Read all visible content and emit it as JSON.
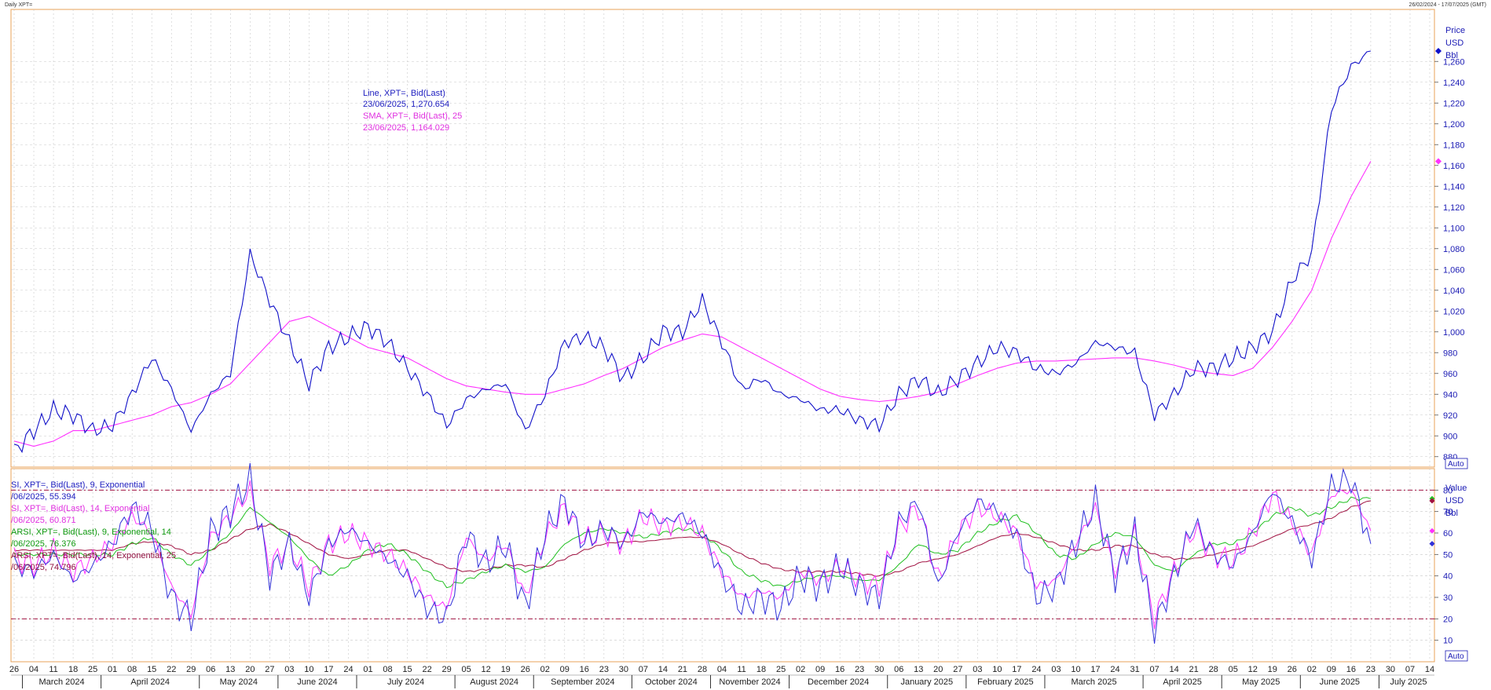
{
  "window": {
    "title_left": "Daily XPT=",
    "title_right": "26/02/2024 - 17/07/2025 (GMT)"
  },
  "colors": {
    "frame": "#e8a35a",
    "grid": "#c8c8c8",
    "price": "#1010c8",
    "sma": "#ff30ff",
    "rsi9": "#3030d8",
    "rsi14": "#ff30ff",
    "marsi9": "#20c020",
    "marsi14": "#a01040",
    "refline": "#a01040",
    "axis_text": "#1a1ab4"
  },
  "price_axis": {
    "label_line1": "Price",
    "label_line2": "USD",
    "label_line3": "Bbl",
    "auto_button": "Auto"
  },
  "rsi_axis": {
    "label_line1": "Value",
    "label_line2": "USD",
    "label_line3": "Bbl",
    "auto_button": "Auto"
  },
  "legend_top": {
    "line1": "Line, XPT=, Bid(Last)",
    "line2": "23/06/2025, 1,270.654",
    "line3": "SMA, XPT=, Bid(Last),  25",
    "line4": "23/06/2025, 1,164.029"
  },
  "legend_bottom": {
    "line1": "SI, XPT=, Bid(Last),  9, Exponential",
    "line2": "/06/2025, 55.394",
    "line3": "SI, XPT=, Bid(Last),  14, Exponential",
    "line4": "/06/2025, 60.871",
    "line5": "ARSI, XPT=, Bid(Last),  9, Exponential, 14",
    "line6": "/06/2025, 76.376",
    "line7": "ARSI, XPT=, Bid(Last),  14, Exponential, 25",
    "line8": "/06/2025, 74.796"
  },
  "chart_data": [
    {
      "type": "line",
      "title": "Daily XPT=",
      "ylabel": "Price USD Bbl",
      "ylim": [
        870,
        1310
      ],
      "yticks": [
        "880",
        "900",
        "920",
        "940",
        "960",
        "980",
        "1,000",
        "1,020",
        "1,040",
        "1,060",
        "1,080",
        "1,100",
        "1,120",
        "1,140",
        "1,160",
        "1,180",
        "1,200",
        "1,220",
        "1,240",
        "1,260"
      ],
      "grid": true,
      "x": [
        "2024-02-26",
        "2024-03-04",
        "2024-03-11",
        "2024-03-18",
        "2024-03-25",
        "2024-04-01",
        "2024-04-08",
        "2024-04-15",
        "2024-04-22",
        "2024-04-29",
        "2024-05-06",
        "2024-05-13",
        "2024-05-20",
        "2024-05-27",
        "2024-06-03",
        "2024-06-10",
        "2024-06-17",
        "2024-06-24",
        "2024-07-01",
        "2024-07-08",
        "2024-07-15",
        "2024-07-22",
        "2024-07-29",
        "2024-08-05",
        "2024-08-12",
        "2024-08-19",
        "2024-08-26",
        "2024-09-02",
        "2024-09-09",
        "2024-09-16",
        "2024-09-23",
        "2024-09-30",
        "2024-10-07",
        "2024-10-14",
        "2024-10-21",
        "2024-10-28",
        "2024-11-04",
        "2024-11-11",
        "2024-11-18",
        "2024-11-25",
        "2024-12-02",
        "2024-12-09",
        "2024-12-16",
        "2024-12-23",
        "2024-12-30",
        "2025-01-06",
        "2025-01-13",
        "2025-01-20",
        "2025-01-27",
        "2025-02-03",
        "2025-02-10",
        "2025-02-17",
        "2025-02-24",
        "2025-03-03",
        "2025-03-10",
        "2025-03-17",
        "2025-03-24",
        "2025-03-31",
        "2025-04-07",
        "2025-04-14",
        "2025-04-21",
        "2025-04-28",
        "2025-05-05",
        "2025-05-12",
        "2025-05-19",
        "2025-05-26",
        "2025-06-02",
        "2025-06-09",
        "2025-06-16",
        "2025-06-23"
      ],
      "series": [
        {
          "name": "Line, XPT=, Bid(Last)",
          "values": [
            885,
            905,
            925,
            920,
            905,
            910,
            940,
            975,
            945,
            905,
            940,
            960,
            1075,
            1030,
            990,
            950,
            985,
            995,
            1005,
            990,
            965,
            940,
            910,
            935,
            945,
            950,
            905,
            940,
            990,
            995,
            985,
            955,
            975,
            1000,
            1000,
            1030,
            990,
            945,
            955,
            940,
            935,
            925,
            925,
            915,
            910,
            940,
            955,
            940,
            955,
            970,
            985,
            980,
            965,
            960,
            970,
            990,
            985,
            980,
            920,
            940,
            965,
            965,
            975,
            985,
            1000,
            1050,
            1075,
            1215,
            1255,
            1270
          ]
        },
        {
          "name": "SMA, XPT=, Bid(Last),  25",
          "values": [
            895,
            890,
            895,
            905,
            905,
            910,
            915,
            920,
            928,
            932,
            940,
            950,
            970,
            990,
            1010,
            1015,
            1005,
            995,
            985,
            980,
            975,
            965,
            955,
            948,
            945,
            942,
            940,
            940,
            945,
            950,
            958,
            965,
            975,
            985,
            992,
            998,
            995,
            985,
            975,
            965,
            955,
            945,
            938,
            935,
            933,
            935,
            938,
            942,
            950,
            958,
            965,
            970,
            972,
            972,
            973,
            974,
            975,
            975,
            972,
            968,
            963,
            960,
            958,
            965,
            985,
            1010,
            1040,
            1090,
            1130,
            1164
          ]
        }
      ]
    },
    {
      "type": "line",
      "ylabel": "Value USD Bbl",
      "ylim": [
        0,
        90
      ],
      "yticks": [
        "10",
        "20",
        "30",
        "40",
        "50",
        "60",
        "70",
        "80"
      ],
      "reference_lines": [
        20,
        80
      ],
      "grid": true,
      "x": [
        "2024-02-26",
        "2024-03-04",
        "2024-03-11",
        "2024-03-18",
        "2024-03-25",
        "2024-04-01",
        "2024-04-08",
        "2024-04-15",
        "2024-04-22",
        "2024-04-29",
        "2024-05-06",
        "2024-05-13",
        "2024-05-20",
        "2024-05-27",
        "2024-06-03",
        "2024-06-10",
        "2024-06-17",
        "2024-06-24",
        "2024-07-01",
        "2024-07-08",
        "2024-07-15",
        "2024-07-22",
        "2024-07-29",
        "2024-08-05",
        "2024-08-12",
        "2024-08-19",
        "2024-08-26",
        "2024-09-02",
        "2024-09-09",
        "2024-09-16",
        "2024-09-23",
        "2024-09-30",
        "2024-10-07",
        "2024-10-14",
        "2024-10-21",
        "2024-10-28",
        "2024-11-04",
        "2024-11-11",
        "2024-11-18",
        "2024-11-25",
        "2024-12-02",
        "2024-12-09",
        "2024-12-16",
        "2024-12-23",
        "2024-12-30",
        "2025-01-06",
        "2025-01-13",
        "2025-01-20",
        "2025-01-27",
        "2025-02-03",
        "2025-02-10",
        "2025-02-17",
        "2025-02-24",
        "2025-03-03",
        "2025-03-10",
        "2025-03-17",
        "2025-03-24",
        "2025-03-31",
        "2025-04-07",
        "2025-04-14",
        "2025-04-21",
        "2025-04-28",
        "2025-05-05",
        "2025-05-12",
        "2025-05-19",
        "2025-05-26",
        "2025-06-02",
        "2025-06-09",
        "2025-06-16",
        "2025-06-23"
      ],
      "series": [
        {
          "name": "SI, XPT=, Bid(Last),  9, Exponential",
          "values": [
            45,
            42,
            50,
            38,
            45,
            55,
            72,
            62,
            30,
            20,
            60,
            70,
            85,
            40,
            55,
            30,
            55,
            62,
            55,
            48,
            40,
            25,
            20,
            60,
            45,
            55,
            25,
            60,
            75,
            55,
            62,
            55,
            70,
            65,
            68,
            60,
            40,
            25,
            30,
            25,
            40,
            35,
            45,
            35,
            30,
            65,
            75,
            35,
            60,
            75,
            70,
            60,
            30,
            35,
            55,
            75,
            40,
            60,
            15,
            40,
            65,
            50,
            45,
            60,
            80,
            65,
            48,
            82,
            85,
            55
          ]
        },
        {
          "name": "SI, XPT=, Bid(Last),  14, Exponential",
          "values": [
            48,
            45,
            52,
            42,
            48,
            55,
            68,
            60,
            35,
            22,
            58,
            68,
            80,
            45,
            55,
            35,
            55,
            60,
            55,
            50,
            42,
            30,
            25,
            58,
            47,
            55,
            30,
            58,
            72,
            57,
            60,
            55,
            68,
            63,
            65,
            60,
            42,
            30,
            33,
            30,
            42,
            38,
            45,
            38,
            35,
            62,
            72,
            38,
            60,
            72,
            68,
            60,
            35,
            38,
            55,
            72,
            42,
            60,
            20,
            42,
            62,
            50,
            47,
            60,
            78,
            65,
            50,
            78,
            80,
            61
          ]
        },
        {
          "name": "ARSI, XPT=, Bid(Last),  9, Exponential, 14",
          "values": [
            50,
            50,
            50,
            50,
            50,
            50,
            55,
            58,
            50,
            45,
            52,
            60,
            72,
            65,
            58,
            48,
            40,
            45,
            52,
            55,
            50,
            42,
            35,
            38,
            42,
            45,
            42,
            44,
            55,
            60,
            62,
            60,
            58,
            60,
            62,
            60,
            52,
            42,
            38,
            35,
            38,
            40,
            40,
            38,
            38,
            45,
            55,
            50,
            52,
            60,
            65,
            68,
            60,
            50,
            48,
            55,
            60,
            58,
            45,
            42,
            50,
            55,
            55,
            60,
            68,
            72,
            68,
            72,
            76,
            76
          ]
        },
        {
          "name": "ARSI, XPT=, Bid(Last),  14, Exponential, 25",
          "values": [
            52,
            52,
            52,
            52,
            52,
            52,
            55,
            56,
            54,
            50,
            52,
            57,
            62,
            64,
            60,
            55,
            50,
            48,
            50,
            52,
            52,
            48,
            44,
            42,
            43,
            45,
            45,
            44,
            48,
            52,
            55,
            56,
            56,
            57,
            58,
            58,
            55,
            50,
            46,
            43,
            42,
            42,
            42,
            41,
            40,
            42,
            46,
            48,
            50,
            54,
            58,
            60,
            58,
            55,
            52,
            52,
            54,
            54,
            50,
            48,
            48,
            50,
            52,
            54,
            58,
            62,
            64,
            67,
            72,
            75
          ]
        }
      ]
    }
  ],
  "x_axis": {
    "day_ticks": [
      "26",
      "04",
      "11",
      "18",
      "25",
      "01",
      "08",
      "15",
      "22",
      "29",
      "06",
      "13",
      "20",
      "27",
      "03",
      "10",
      "17",
      "24",
      "01",
      "08",
      "15",
      "22",
      "29",
      "05",
      "12",
      "19",
      "26",
      "02",
      "09",
      "16",
      "23",
      "30",
      "07",
      "14",
      "21",
      "28",
      "04",
      "11",
      "18",
      "25",
      "02",
      "09",
      "16",
      "23",
      "30",
      "06",
      "13",
      "20",
      "27",
      "03",
      "10",
      "17",
      "24",
      "03",
      "10",
      "17",
      "24",
      "31",
      "07",
      "14",
      "21",
      "28",
      "05",
      "12",
      "19",
      "26",
      "02",
      "09",
      "16",
      "23",
      "30",
      "07",
      "14"
    ],
    "months": [
      "March 2024",
      "April 2024",
      "May 2024",
      "June 2024",
      "July 2024",
      "August 2024",
      "September 2024",
      "October 2024",
      "November 2024",
      "December 2024",
      "January 2025",
      "February 2025",
      "March 2025",
      "April 2025",
      "May 2025",
      "June 2025",
      "July 2025"
    ]
  }
}
